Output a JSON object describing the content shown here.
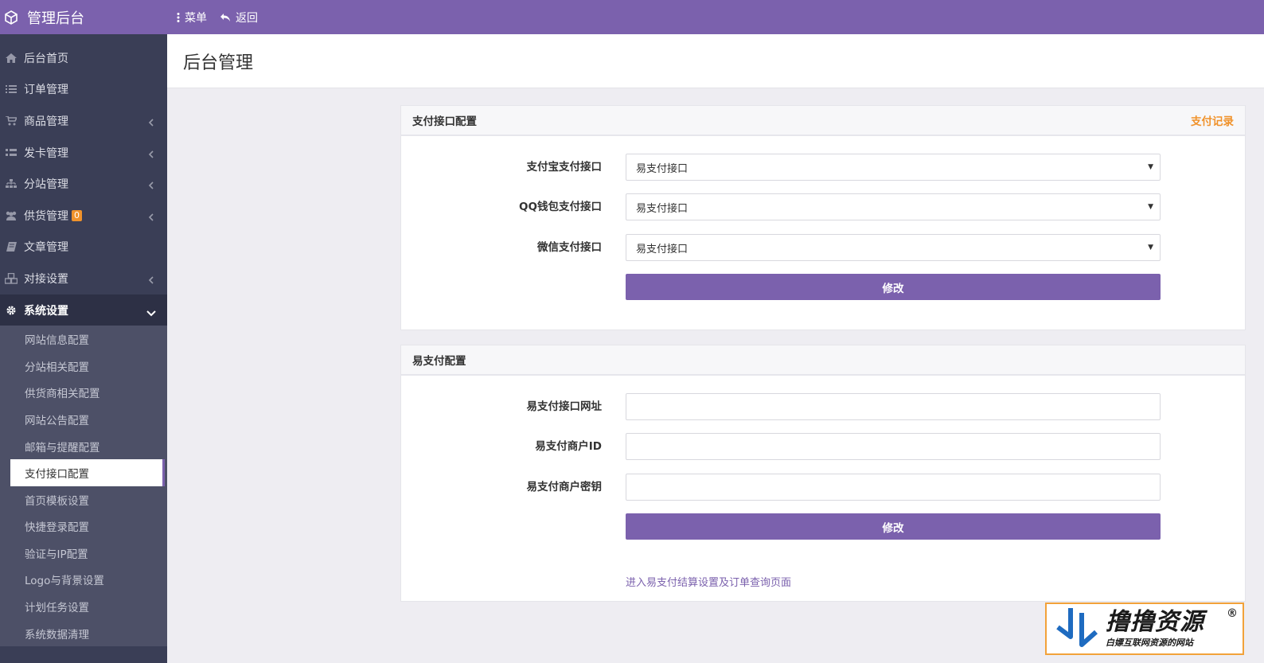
{
  "topbar": {
    "title": "管理后台",
    "menu_label": "菜单",
    "back_label": "返回",
    "color": "#7b61ad"
  },
  "sidebar": {
    "items": [
      {
        "label": "后台首页",
        "icon": "home-icon"
      },
      {
        "label": "订单管理",
        "icon": "list-icon"
      },
      {
        "label": "商品管理",
        "icon": "cart-icon",
        "has_children": true
      },
      {
        "label": "发卡管理",
        "icon": "grid-icon",
        "has_children": true
      },
      {
        "label": "分站管理",
        "icon": "sitemap-icon",
        "has_children": true
      },
      {
        "label": "供货管理",
        "icon": "users-icon",
        "has_children": true,
        "badge": "0"
      },
      {
        "label": "文章管理",
        "icon": "book-icon"
      },
      {
        "label": "对接设置",
        "icon": "cubes-icon",
        "has_children": true
      },
      {
        "label": "系统设置",
        "icon": "gear-icon",
        "has_children": true,
        "expanded": true
      }
    ],
    "submenu": [
      "网站信息配置",
      "分站相关配置",
      "供货商相关配置",
      "网站公告配置",
      "邮箱与提醒配置",
      "支付接口配置",
      "首页模板设置",
      "快捷登录配置",
      "验证与IP配置",
      "Logo与背景设置",
      "计划任务设置",
      "系统数据清理"
    ],
    "active_sub": "支付接口配置"
  },
  "page": {
    "title": "后台管理"
  },
  "payment_panel": {
    "title": "支付接口配置",
    "record_link": "支付记录",
    "fields": [
      {
        "label": "支付宝支付接口",
        "value": "易支付接口"
      },
      {
        "label": "QQ钱包支付接口",
        "value": "易支付接口"
      },
      {
        "label": "微信支付接口",
        "value": "易支付接口"
      }
    ],
    "submit_label": "修改"
  },
  "epay_panel": {
    "title": "易支付配置",
    "fields": [
      {
        "label": "易支付接口网址",
        "value": ""
      },
      {
        "label": "易支付商户ID",
        "value": ""
      },
      {
        "label": "易支付商户密钥",
        "value": ""
      }
    ],
    "submit_label": "修改",
    "footer_link": "进入易支付结算设置及订单查询页面"
  },
  "watermark": {
    "title": "撸撸资源",
    "subtitle": "白嫖互联网资源的网站",
    "reg": "®"
  }
}
